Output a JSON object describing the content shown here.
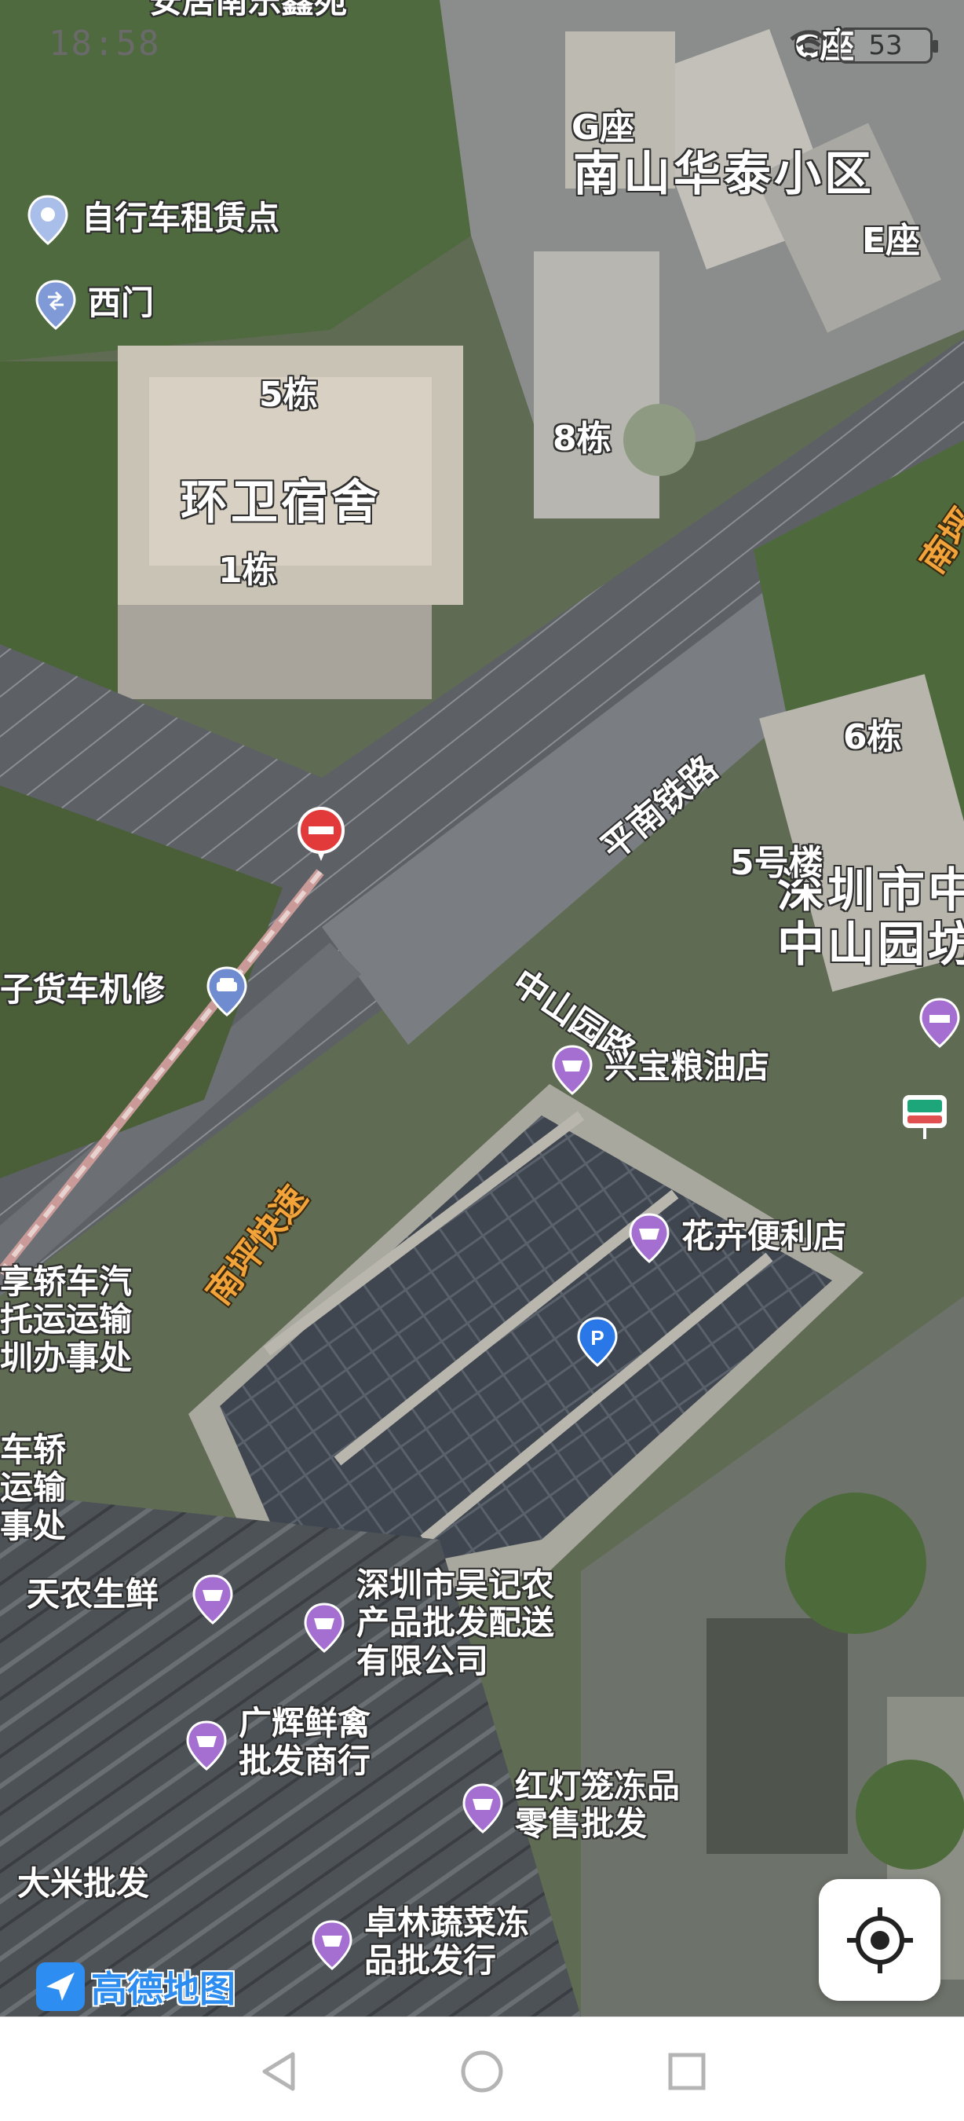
{
  "status_bar": {
    "time": "18:58",
    "battery": "53"
  },
  "map": {
    "areas": [
      {
        "key": "nanshan_huatai",
        "text": "南山华泰小区"
      },
      {
        "key": "huanwei",
        "text": "环卫宿舍"
      },
      {
        "key": "zhongshanyuan",
        "text": "深圳市中\n中山园坊"
      }
    ],
    "buildings": [
      {
        "key": "g_zuo",
        "text": "G座"
      },
      {
        "key": "e_zuo",
        "text": "E座"
      },
      {
        "key": "c_zuo",
        "text": "C座"
      },
      {
        "key": "dong5",
        "text": "5栋"
      },
      {
        "key": "dong8",
        "text": "8栋"
      },
      {
        "key": "dong1",
        "text": "1栋"
      },
      {
        "key": "dong6",
        "text": "6栋"
      },
      {
        "key": "hao5",
        "text": "5号楼"
      }
    ],
    "roads": [
      {
        "key": "pingnan_railway",
        "text": "平南铁路"
      },
      {
        "key": "zhongshanyuan_road",
        "text": "中山园路"
      },
      {
        "key": "nanping_expressway",
        "text": "南坪快速"
      },
      {
        "key": "nanping_edge",
        "text": "南坪"
      }
    ],
    "pois": [
      {
        "key": "top_cut",
        "text": "安居南乐鑫苑"
      },
      {
        "key": "bike_rental",
        "text": "自行车租赁点"
      },
      {
        "key": "west_gate",
        "text": "西门"
      },
      {
        "key": "truck_repair",
        "text": "子货车机修"
      },
      {
        "key": "xingbao",
        "text": "兴宝粮油店"
      },
      {
        "key": "huahui",
        "text": "花卉便利店"
      },
      {
        "key": "tiannong",
        "text": "天农生鲜"
      },
      {
        "key": "wuji",
        "text": "深圳市吴记农\n产品批发配送\n有限公司"
      },
      {
        "key": "guanghui",
        "text": "广辉鲜禽\n批发商行"
      },
      {
        "key": "hongdenglong",
        "text": "红灯笼冻品\n零售批发"
      },
      {
        "key": "dami",
        "text": "大米批发"
      },
      {
        "key": "zhuolin",
        "text": "卓林蔬菜冻\n品批发行"
      },
      {
        "key": "car_transport_1",
        "text": "享轿车汽\n托运运输\n圳办事处"
      },
      {
        "key": "car_transport_2",
        "text": "车轿\n运输\n事处"
      }
    ]
  },
  "logo": {
    "text": "高德地图"
  },
  "controls": {
    "locate": "locate-me"
  },
  "icons": [
    "location-pin-icon",
    "gate-icon",
    "car-icon",
    "shopping-basket-icon",
    "parking-icon",
    "no-entry-icon",
    "hotel-icon",
    "bus-stop-icon",
    "locate-icon",
    "back-icon",
    "home-icon",
    "recents-icon"
  ]
}
